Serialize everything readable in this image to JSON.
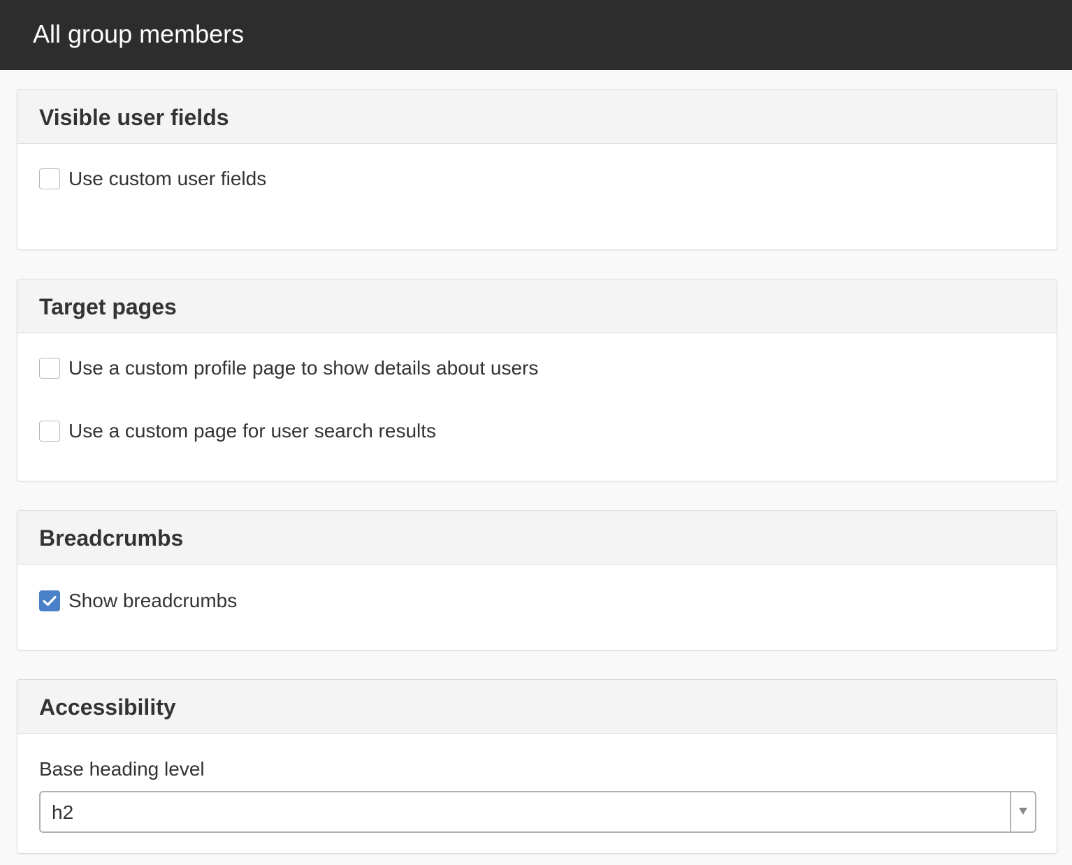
{
  "header": {
    "title": "All group members"
  },
  "panels": {
    "visible_user_fields": {
      "title": "Visible user fields",
      "options": [
        {
          "label": "Use custom user fields",
          "checked": false
        }
      ]
    },
    "target_pages": {
      "title": "Target pages",
      "options": [
        {
          "label": "Use a custom profile page to show details about users",
          "checked": false
        },
        {
          "label": "Use a custom page for user search results",
          "checked": false
        }
      ]
    },
    "breadcrumbs": {
      "title": "Breadcrumbs",
      "options": [
        {
          "label": "Show breadcrumbs",
          "checked": true
        }
      ]
    },
    "accessibility": {
      "title": "Accessibility",
      "base_heading_label": "Base heading level",
      "base_heading_value": "h2"
    }
  },
  "icons": {
    "check": "checkmark-icon",
    "dropdown": "chevron-down-icon"
  },
  "colors": {
    "topbar": "#2d2d2d",
    "checkbox_checked": "#4a80c8",
    "panel_header": "#f4f4f4",
    "page_background": "#f9f9f9"
  }
}
